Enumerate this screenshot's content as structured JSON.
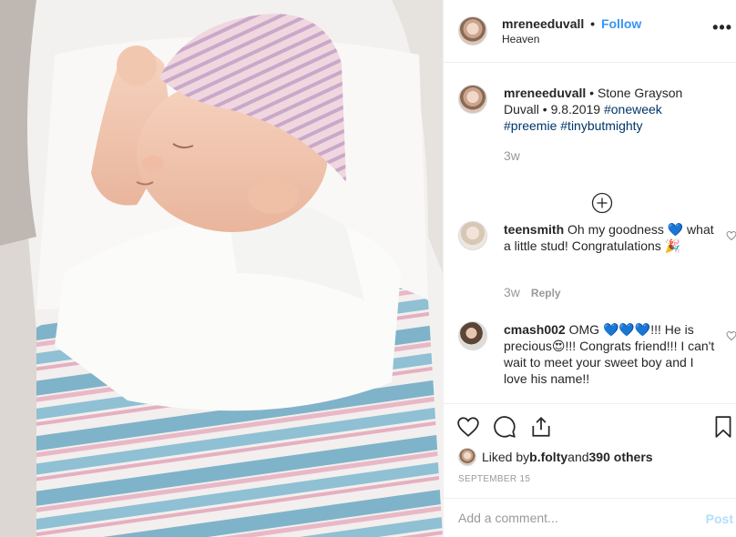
{
  "post": {
    "author": "mreneeduvall",
    "dot": "•",
    "follow_label": "Follow",
    "location": "Heaven",
    "more_label": "•••",
    "photo_alt": "newborn baby"
  },
  "comments": [
    {
      "username": "mreneeduvall",
      "text_before": " • Stone Grayson Duvall • 9.8.2019 ",
      "hashtags": [
        "#oneweek",
        "#preemie",
        "#tinybutmighty"
      ],
      "time": "3w"
    },
    {
      "username": "teensmith",
      "text": " Oh my goodness 💙 what a little stud! Congratulations 🎉",
      "time": "3w",
      "reply_label": "Reply"
    },
    {
      "username": "cmash002",
      "text": " OMG 💙💙💙!!! He is precious😍!!! Congrats friend!!! I can't wait to meet your sweet boy and I love his name!!"
    }
  ],
  "likes": {
    "prefix": "Liked by ",
    "user": "b.folty",
    "mid": " and ",
    "others": "390 others"
  },
  "date": "SEPTEMBER 15",
  "comment_box": {
    "placeholder": "Add a comment...",
    "post_label": "Post"
  },
  "icons": {
    "heart": "heart-icon",
    "comment": "comment-icon",
    "share": "share-icon",
    "bookmark": "bookmark-icon",
    "load_more": "plus-circle-icon"
  },
  "colors": {
    "link": "#3897f0",
    "hashtag": "#003569",
    "muted": "#999999",
    "post_disabled": "#b2dffc"
  }
}
